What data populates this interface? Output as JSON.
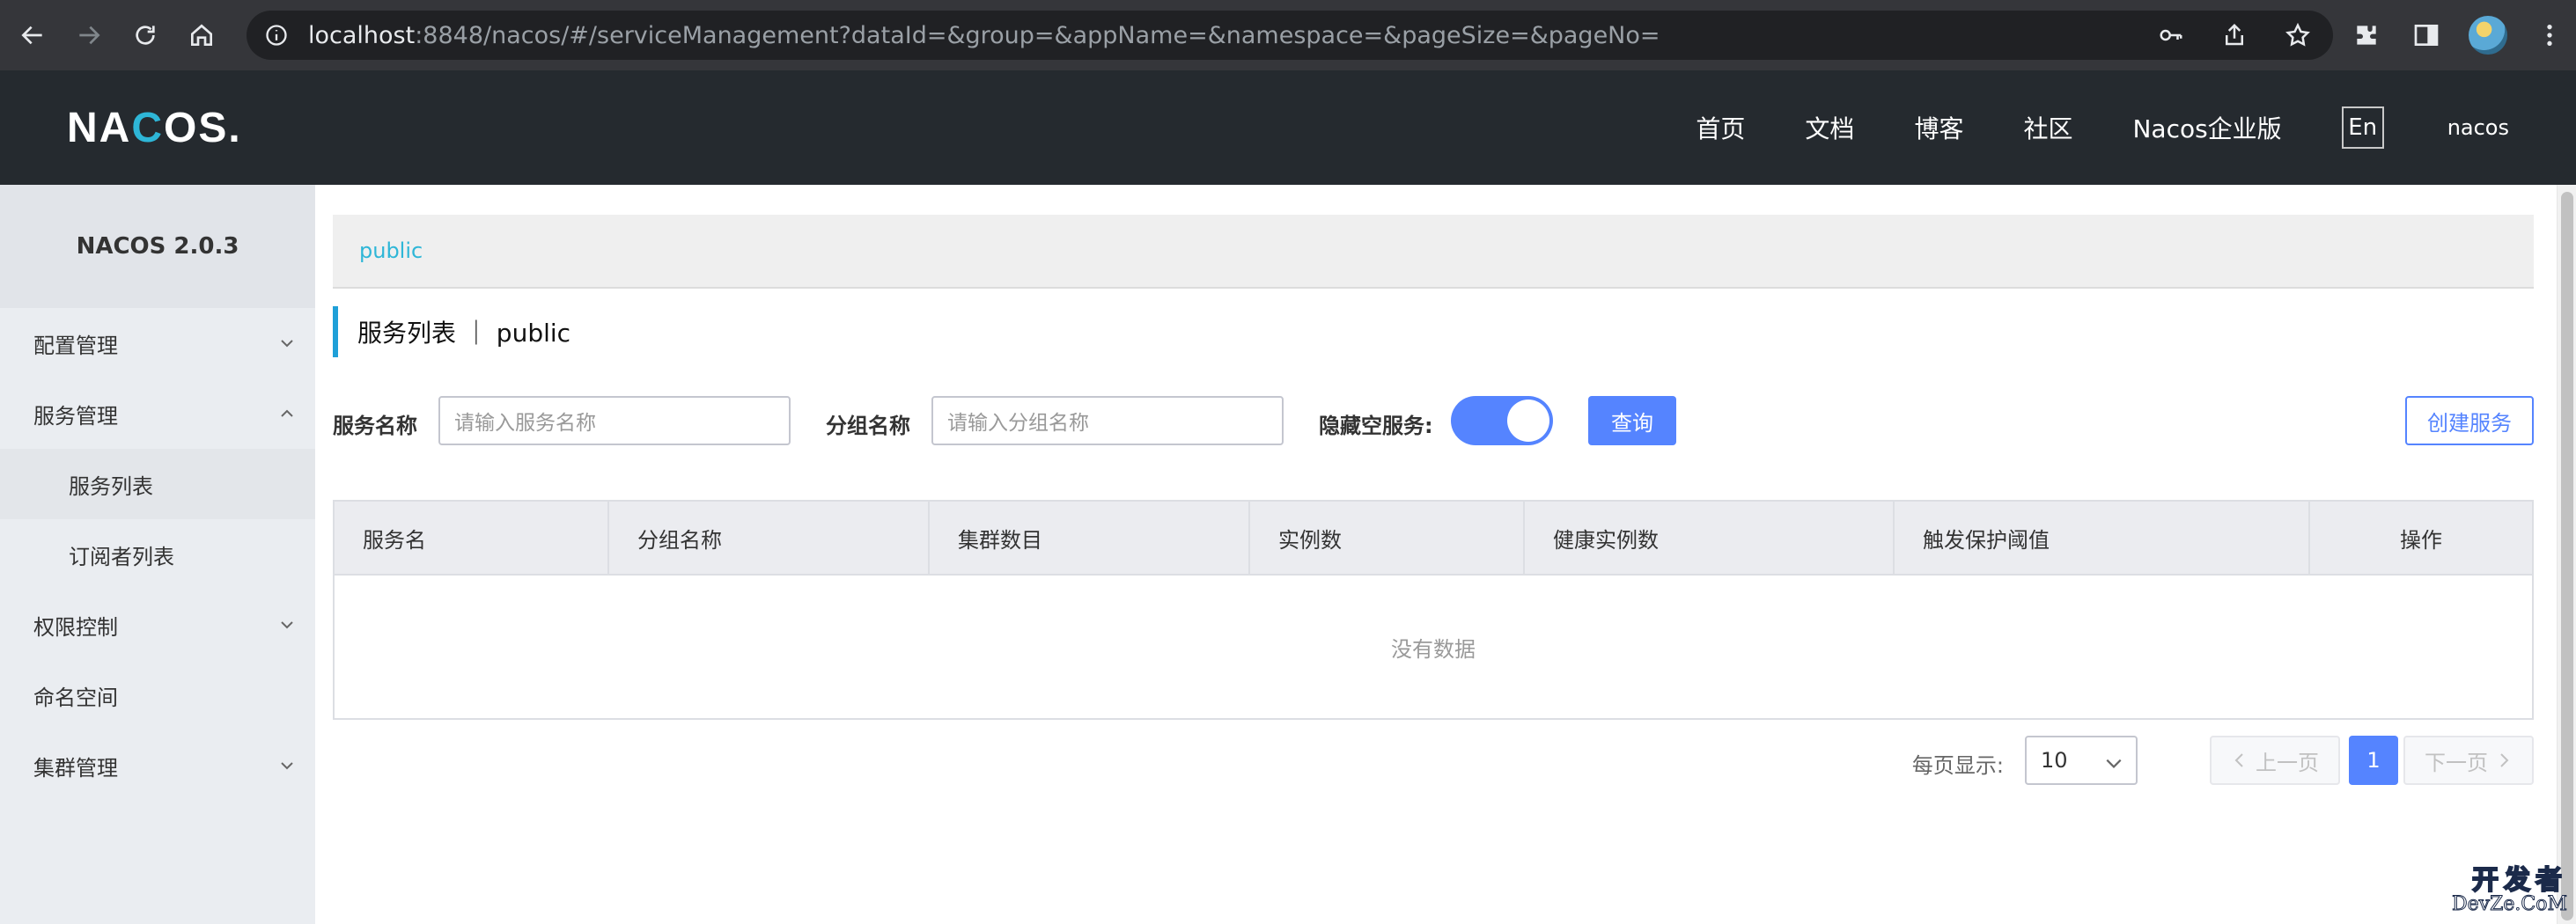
{
  "browser": {
    "url_host": "localhost",
    "url_rest": ":8848/nacos/#/serviceManagement?dataId=&group=&appName=&namespace=&pageSize=&pageNo="
  },
  "header": {
    "logo_pre": "NA",
    "logo_c": "C",
    "logo_post": "OS.",
    "nav": [
      "首页",
      "文档",
      "博客",
      "社区",
      "Nacos企业版"
    ],
    "lang": "En",
    "user": "nacos"
  },
  "sidebar": {
    "title": "NACOS 2.0.3",
    "items": [
      {
        "label": "配置管理",
        "chevron": "down"
      },
      {
        "label": "服务管理",
        "chevron": "up"
      },
      {
        "label": "服务列表",
        "sub": true,
        "active": true
      },
      {
        "label": "订阅者列表",
        "sub": true
      },
      {
        "label": "权限控制",
        "chevron": "down"
      },
      {
        "label": "命名空间"
      },
      {
        "label": "集群管理",
        "chevron": "down"
      }
    ]
  },
  "main": {
    "namespace": "public",
    "title": "服务列表 ｜ public",
    "filters": {
      "service_label": "服务名称",
      "service_placeholder": "请输入服务名称",
      "group_label": "分组名称",
      "group_placeholder": "请输入分组名称",
      "hide_empty_label": "隐藏空服务:",
      "hide_empty_on": true,
      "query_button": "查询",
      "create_button": "创建服务"
    },
    "table": {
      "columns": [
        "服务名",
        "分组名称",
        "集群数目",
        "实例数",
        "健康实例数",
        "触发保护阈值",
        "操作"
      ],
      "empty_text": "没有数据"
    },
    "pagination": {
      "page_size_label": "每页显示:",
      "page_size": "10",
      "prev": "上一页",
      "current": "1",
      "next": "下一页"
    }
  },
  "watermark": {
    "line1": "开发者",
    "line2": "DevZe.CoM"
  },
  "colors": {
    "primary": "#5584ff",
    "accent": "#2eb6d7",
    "header_bg": "#252a2f",
    "sidebar_bg": "#eaedf1"
  }
}
